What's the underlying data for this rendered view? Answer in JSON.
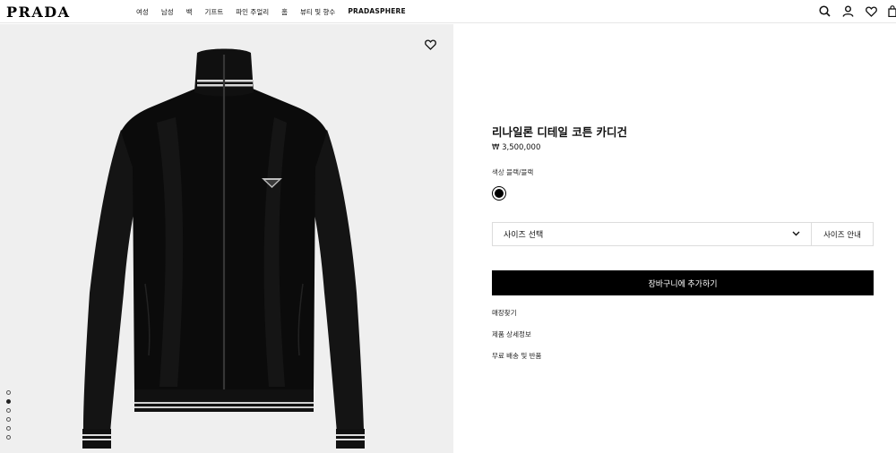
{
  "header": {
    "logo": "PRADA",
    "nav": [
      "여성",
      "남성",
      "백",
      "기프트",
      "파인 주얼리",
      "홈",
      "뷰티 및 향수",
      "PRADASPHERE"
    ],
    "icons": [
      "search-icon",
      "account-icon",
      "wishlist-icon",
      "bag-icon"
    ]
  },
  "media": {
    "wishlist_icon": "heart-icon",
    "carousel": {
      "total": 6,
      "active_index": 2
    }
  },
  "product": {
    "title": "리나일론 디테일 코튼 카디건",
    "price": "₩ 3,500,000",
    "color_label": "색상  블랙/블랙",
    "color_swatch": "#000000",
    "size_select": "사이즈 선택",
    "size_guide": "사이즈 안내",
    "add_to_cart": "장바구니에 추가하기",
    "links": [
      "매장찾기",
      "제품 상세정보",
      "무료 배송 및 반품"
    ]
  }
}
